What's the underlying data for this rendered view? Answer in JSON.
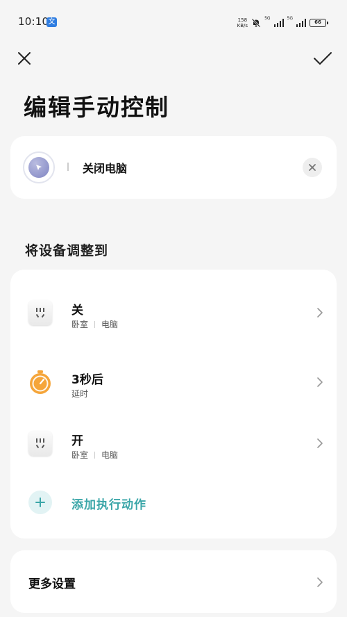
{
  "status_bar": {
    "time": "10:10",
    "app_icon_glyph": "文",
    "net_speed_value": "158",
    "net_speed_unit": "KB/s",
    "signal_1_label": "5G",
    "signal_2_label": "5G",
    "battery": "66"
  },
  "header": {
    "title": "编辑手动控制"
  },
  "trigger": {
    "name": "关闭电脑"
  },
  "section": {
    "title": "将设备调整到"
  },
  "actions": [
    {
      "title": "关",
      "room": "卧室",
      "device": "电脑",
      "icon": "socket-icon"
    },
    {
      "title": "3秒后",
      "subtitle": "延时",
      "icon": "timer-icon"
    },
    {
      "title": "开",
      "room": "卧室",
      "device": "电脑",
      "icon": "socket-icon"
    }
  ],
  "add_action": {
    "label": "添加执行动作"
  },
  "more_settings": {
    "label": "更多设置"
  },
  "colors": {
    "accent_teal": "#3aa6a8",
    "timer_orange": "#f5a53a",
    "background": "#f5f5f5"
  }
}
